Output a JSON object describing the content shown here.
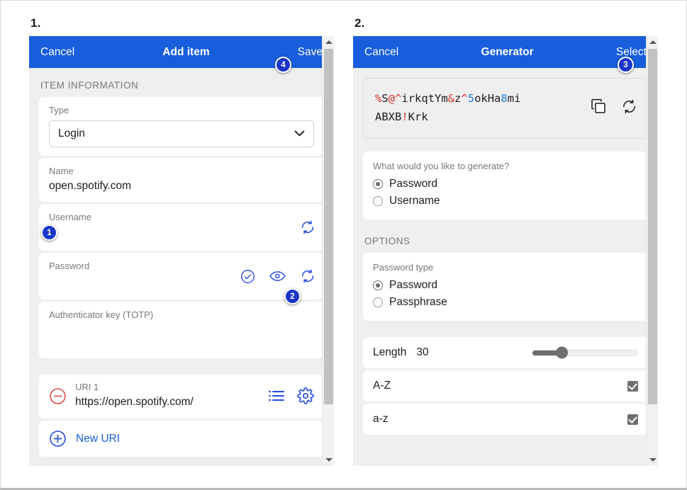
{
  "panels": [
    {
      "step_label": "1.",
      "navbar": {
        "cancel": "Cancel",
        "title": "Add item",
        "action": "Save"
      },
      "section_heading": "ITEM INFORMATION",
      "fields": {
        "type": {
          "label": "Type",
          "value": "Login"
        },
        "name": {
          "label": "Name",
          "value": "open.spotify.com"
        },
        "username": {
          "label": "Username",
          "value": ""
        },
        "password": {
          "label": "Password",
          "value": ""
        },
        "totp": {
          "label": "Authenticator key (TOTP)",
          "value": ""
        }
      },
      "uri": {
        "label": "URI 1",
        "value": "https://open.spotify.com/"
      },
      "new_uri_label": "New URI",
      "badges": [
        {
          "number": "1",
          "target": "username-field"
        },
        {
          "number": "2",
          "target": "password-generate-icon"
        },
        {
          "number": "4",
          "target": "save-button"
        }
      ]
    },
    {
      "step_label": "2.",
      "navbar": {
        "cancel": "Cancel",
        "title": "Generator",
        "action": "Select"
      },
      "generated_password": {
        "line1": [
          {
            "t": "%",
            "c": "sym"
          },
          {
            "t": "S",
            "c": ""
          },
          {
            "t": "@^",
            "c": "sym"
          },
          {
            "t": "irkqtYm",
            "c": ""
          },
          {
            "t": "&",
            "c": "sym"
          },
          {
            "t": "z",
            "c": ""
          },
          {
            "t": "^",
            "c": "sym"
          },
          {
            "t": "5",
            "c": "num"
          },
          {
            "t": "okHa",
            "c": ""
          },
          {
            "t": "8",
            "c": "num"
          },
          {
            "t": "mi",
            "c": ""
          }
        ],
        "line2": [
          {
            "t": "ABXB",
            "c": ""
          },
          {
            "t": "!",
            "c": "sym"
          },
          {
            "t": "Krk",
            "c": ""
          }
        ],
        "plain": "%S@^irkqtYm&z^5okHa8miABXB!Krk"
      },
      "generate_question": {
        "label": "What would you like to generate?",
        "options": [
          {
            "label": "Password",
            "selected": true
          },
          {
            "label": "Username",
            "selected": false
          }
        ]
      },
      "options_heading": "OPTIONS",
      "password_type": {
        "label": "Password type",
        "options": [
          {
            "label": "Password",
            "selected": true
          },
          {
            "label": "Passphrase",
            "selected": false
          }
        ]
      },
      "length": {
        "label": "Length",
        "value": "30",
        "percent": 28
      },
      "toggles": [
        {
          "label": "A-Z",
          "checked": true
        },
        {
          "label": "a-z",
          "checked": true
        }
      ],
      "badges": [
        {
          "number": "3",
          "target": "select-button"
        }
      ]
    }
  ],
  "colors": {
    "brand_blue": "#175ddc",
    "badge_blue": "#1a35c8",
    "symbol_red": "#d3302f",
    "number_blue": "#1e7ae0",
    "panel_bg": "#efefef",
    "danger_red": "#d9534f"
  }
}
